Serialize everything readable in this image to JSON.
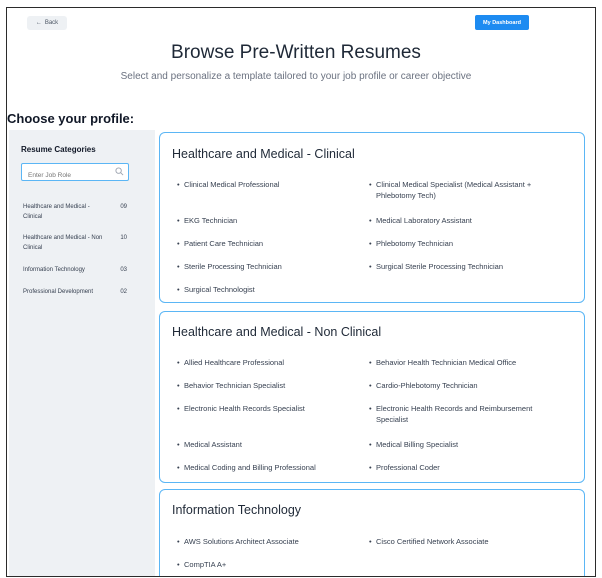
{
  "header": {
    "back_label": "Back",
    "dashboard_label": "My Dashboard"
  },
  "page": {
    "title": "Browse Pre-Written Resumes",
    "subtitle": "Select and personalize a template tailored to your job profile or career objective",
    "choose_label": "Choose your profile:"
  },
  "sidebar": {
    "heading": "Resume Categories",
    "search_placeholder": "Enter Job Role",
    "categories": [
      {
        "label": "Healthcare and Medical - Clinical",
        "count": "09"
      },
      {
        "label": "Healthcare and Medical - Non Clinical",
        "count": "10"
      },
      {
        "label": "Information Technology",
        "count": "03"
      },
      {
        "label": "Professional Development",
        "count": "02"
      }
    ]
  },
  "sections": [
    {
      "title": "Healthcare and Medical - Clinical",
      "items": [
        "Clinical Medical Professional",
        "Clinical Medical Specialist (Medical Assistant + Phlebotomy Tech)",
        "EKG Technician",
        "Medical Laboratory Assistant",
        "Patient Care Technician",
        "Phlebotomy Technician",
        "Sterile Processing Technician",
        "Surgical Sterile Processing Technician",
        "Surgical Technologist"
      ]
    },
    {
      "title": "Healthcare and Medical - Non Clinical",
      "items": [
        "Allied Healthcare Professional",
        "Behavior Health Technician Medical Office",
        "Behavior Technician Specialist",
        "Cardio-Phlebotomy Technician",
        "Electronic Health Records Specialist",
        "Electronic Health Records and Reimbursement Specialist",
        "Medical Assistant",
        "Medical Billing Specialist",
        "Medical Coding and Billing Professional",
        "Professional Coder"
      ]
    },
    {
      "title": "Information Technology",
      "items": [
        "AWS Solutions Architect Associate",
        "Cisco Certified Network Associate",
        "CompTIA A+"
      ]
    }
  ],
  "colors": {
    "accent": "#1d8bf1",
    "card_border": "#5bb6f5",
    "sidebar_bg": "#eef1f4"
  },
  "icons": {
    "back": "arrow-left-icon",
    "search": "search-icon",
    "bullet": "bullet-icon"
  }
}
